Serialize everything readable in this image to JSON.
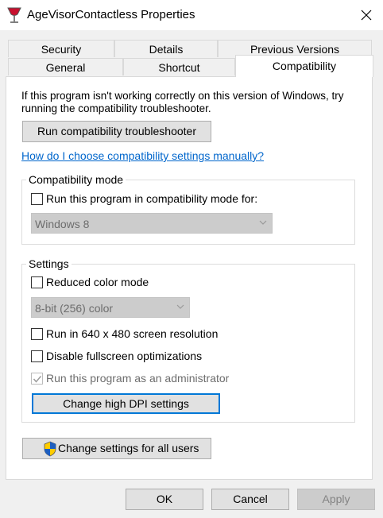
{
  "window": {
    "title": "AgeVisorContactless Properties"
  },
  "tabs": {
    "row1": [
      {
        "label": "Security"
      },
      {
        "label": "Details"
      },
      {
        "label": "Previous Versions"
      }
    ],
    "row2": [
      {
        "label": "General"
      },
      {
        "label": "Shortcut"
      },
      {
        "label": "Compatibility",
        "active": true
      }
    ]
  },
  "compat": {
    "intro": "If this program isn't working correctly on this version of Windows, try running the compatibility troubleshooter.",
    "troubleshooter_button": "Run compatibility troubleshooter",
    "help_link": "How do I choose compatibility settings manually?",
    "mode_group": {
      "title": "Compatibility mode",
      "checkbox_label": "Run this program in compatibility mode for:",
      "checked": false,
      "os_select_value": "Windows 8"
    },
    "settings_group": {
      "title": "Settings",
      "reduced_color": {
        "label": "Reduced color mode",
        "checked": false
      },
      "color_select_value": "8-bit (256) color",
      "run_640": {
        "label": "Run in 640 x 480 screen resolution",
        "checked": false
      },
      "disable_fullscreen": {
        "label": "Disable fullscreen optimizations",
        "checked": false
      },
      "run_admin": {
        "label": "Run this program as an administrator",
        "checked": true,
        "disabled": true
      },
      "dpi_button": "Change high DPI settings"
    },
    "all_users_button": "Change settings for all users"
  },
  "footer": {
    "ok": "OK",
    "cancel": "Cancel",
    "apply": "Apply"
  },
  "colors": {
    "link": "#0066cc",
    "focus_border": "#0078d7",
    "panel_bg": "#ffffff",
    "window_bg": "#f0f0f0"
  },
  "icons": {
    "app": "wine-glass-icon",
    "close": "close-icon",
    "shield": "uac-shield-icon",
    "dropdown": "chevron-down-icon"
  }
}
